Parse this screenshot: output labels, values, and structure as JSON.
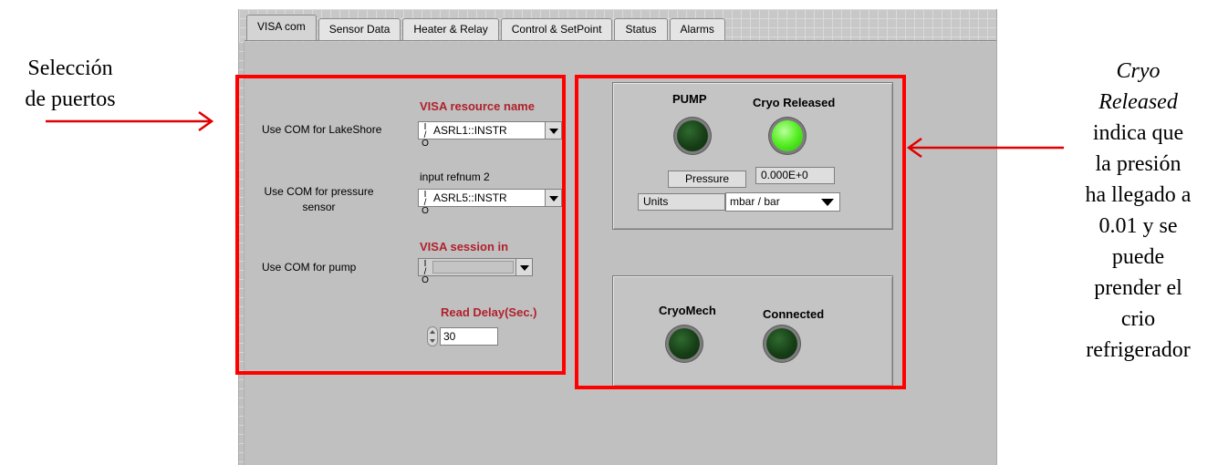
{
  "tabs": [
    "VISA com",
    "Sensor Data",
    "Heater & Relay",
    "Control & SetPoint",
    "Status",
    "Alarms"
  ],
  "ports": {
    "lakeshore_label": "Use COM for LakeShore",
    "visa_resource_header": "VISA resource name",
    "lakeshore_value": "ASRL1::INSTR",
    "input_refnum_label": "input refnum 2",
    "pressure_label_line1": "Use COM for pressure",
    "pressure_label_line2": "sensor",
    "pressure_value": "ASRL5::INSTR",
    "visa_session_header": "VISA session in",
    "pump_label": "Use COM for pump",
    "pump_value": "",
    "read_delay_header": "Read Delay(Sec.)",
    "read_delay_value": "30",
    "io_glyph": "I/O"
  },
  "status": {
    "pump_label": "PUMP",
    "pump_led_on": false,
    "cryo_released_label": "Cryo Released",
    "cryo_released_on": true,
    "pressure_label": "Pressure",
    "pressure_value": "0.000E+0",
    "units_label": "Units",
    "units_value": "mbar / bar",
    "cryomech_label": "CryoMech",
    "cryomech_on": false,
    "connected_label": "Connected",
    "connected_on": false
  },
  "annotations": {
    "left_line1": "Selección",
    "left_line2": "de puertos",
    "right_italic_1": "Cryo",
    "right_italic_2": "Released",
    "right_lines": [
      "indica que",
      "la presión",
      "ha llegado a",
      "0.01 y se",
      "puede",
      "prender el",
      "crio",
      "refrigerador"
    ]
  },
  "colors": {
    "highlight_red": "#ff0000",
    "header_red": "#b1202c",
    "led_off": "#173f17",
    "led_on": "#55ee22",
    "panel_gray": "#c0c0c0"
  }
}
